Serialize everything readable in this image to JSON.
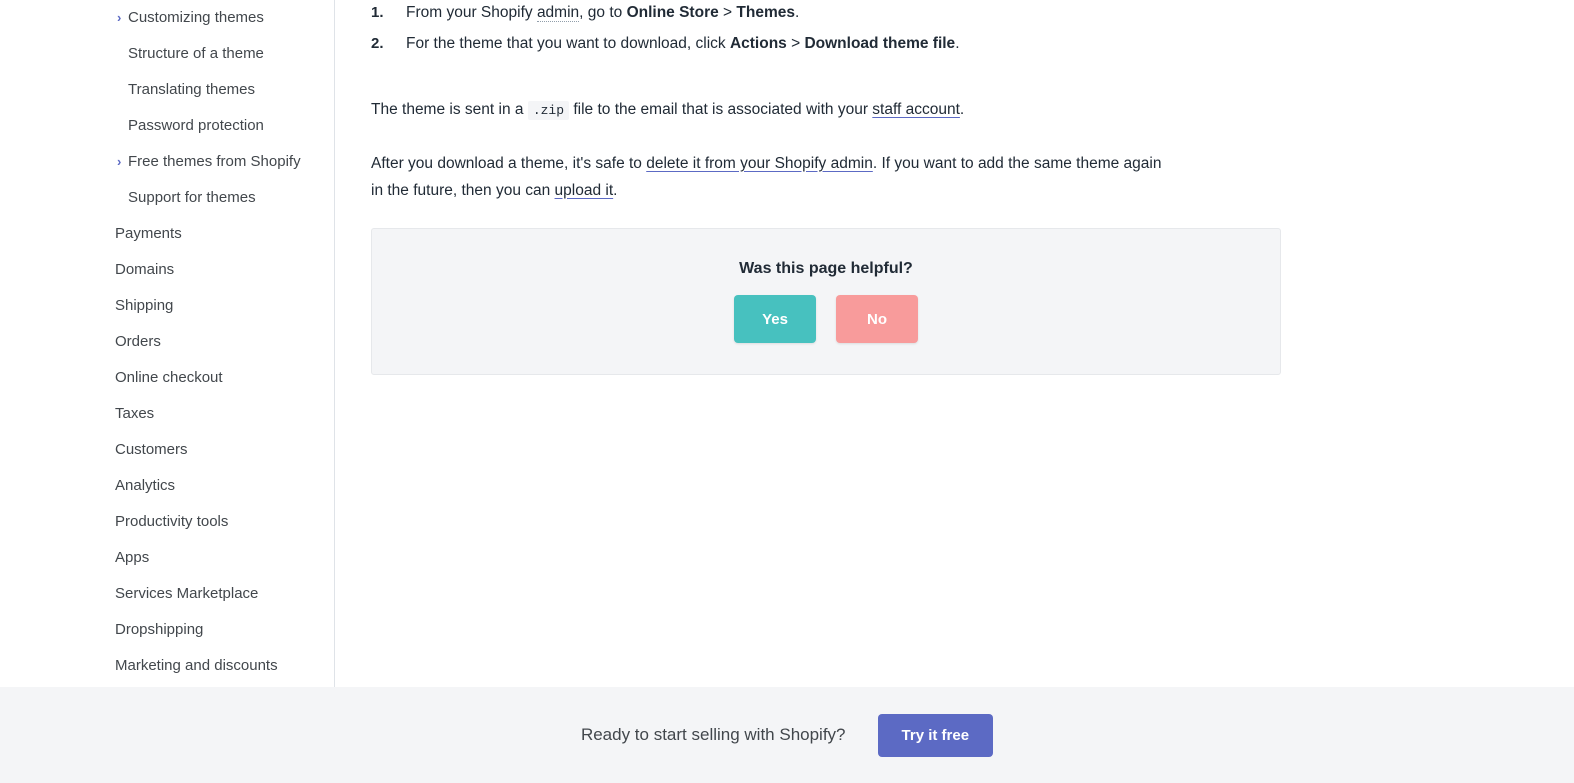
{
  "sidebar": {
    "items": [
      {
        "label": "Customizing themes",
        "level": 2,
        "chevron": "›"
      },
      {
        "label": "Structure of a theme",
        "level": 2,
        "chevron": ""
      },
      {
        "label": "Translating themes",
        "level": 2,
        "chevron": ""
      },
      {
        "label": "Password protection",
        "level": 2,
        "chevron": ""
      },
      {
        "label": "Free themes from Shopify",
        "level": 2,
        "chevron": "›"
      },
      {
        "label": "Support for themes",
        "level": 2,
        "chevron": ""
      },
      {
        "label": "Payments",
        "level": 1,
        "chevron": ""
      },
      {
        "label": "Domains",
        "level": 1,
        "chevron": ""
      },
      {
        "label": "Shipping",
        "level": 1,
        "chevron": ""
      },
      {
        "label": "Orders",
        "level": 1,
        "chevron": ""
      },
      {
        "label": "Online checkout",
        "level": 1,
        "chevron": ""
      },
      {
        "label": "Taxes",
        "level": 1,
        "chevron": ""
      },
      {
        "label": "Customers",
        "level": 1,
        "chevron": ""
      },
      {
        "label": "Analytics",
        "level": 1,
        "chevron": ""
      },
      {
        "label": "Productivity tools",
        "level": 1,
        "chevron": ""
      },
      {
        "label": "Apps",
        "level": 1,
        "chevron": ""
      },
      {
        "label": "Services Marketplace",
        "level": 1,
        "chevron": ""
      },
      {
        "label": "Dropshipping",
        "level": 1,
        "chevron": ""
      },
      {
        "label": "Marketing and discounts",
        "level": 1,
        "chevron": ""
      }
    ]
  },
  "main": {
    "steps": [
      {
        "marker": "1.",
        "part1": "From your Shopify ",
        "glossary": "admin",
        "part2": ", go to ",
        "bold1": "Online Store",
        "part3": " > ",
        "bold2": "Themes",
        "part4": "."
      },
      {
        "marker": "2.",
        "part1": "For the theme that you want to download, click ",
        "glossary": "",
        "part2": "",
        "bold1": "Actions",
        "part3": " > ",
        "bold2": "Download theme file",
        "part4": "."
      }
    ],
    "paragraph1": {
      "part1": "The theme is sent in a ",
      "code": ".zip",
      "part2": " file to the email that is associated with your ",
      "link": "staff account",
      "part3": "."
    },
    "paragraph2": {
      "part1": "After you download a theme, it's safe to ",
      "link1": "delete it from your Shopify admin",
      "part2": ". If you want to add the same theme again in the future, then you can ",
      "link2": "upload it",
      "part3": "."
    },
    "feedback": {
      "title": "Was this page helpful?",
      "yes_label": "Yes",
      "no_label": "No",
      "yes_color": "#47c1bf",
      "no_color": "#f89b9b"
    }
  },
  "footer": {
    "text": "Ready to start selling with Shopify?",
    "cta_label": "Try it free",
    "cta_color": "#5c6ac4"
  }
}
